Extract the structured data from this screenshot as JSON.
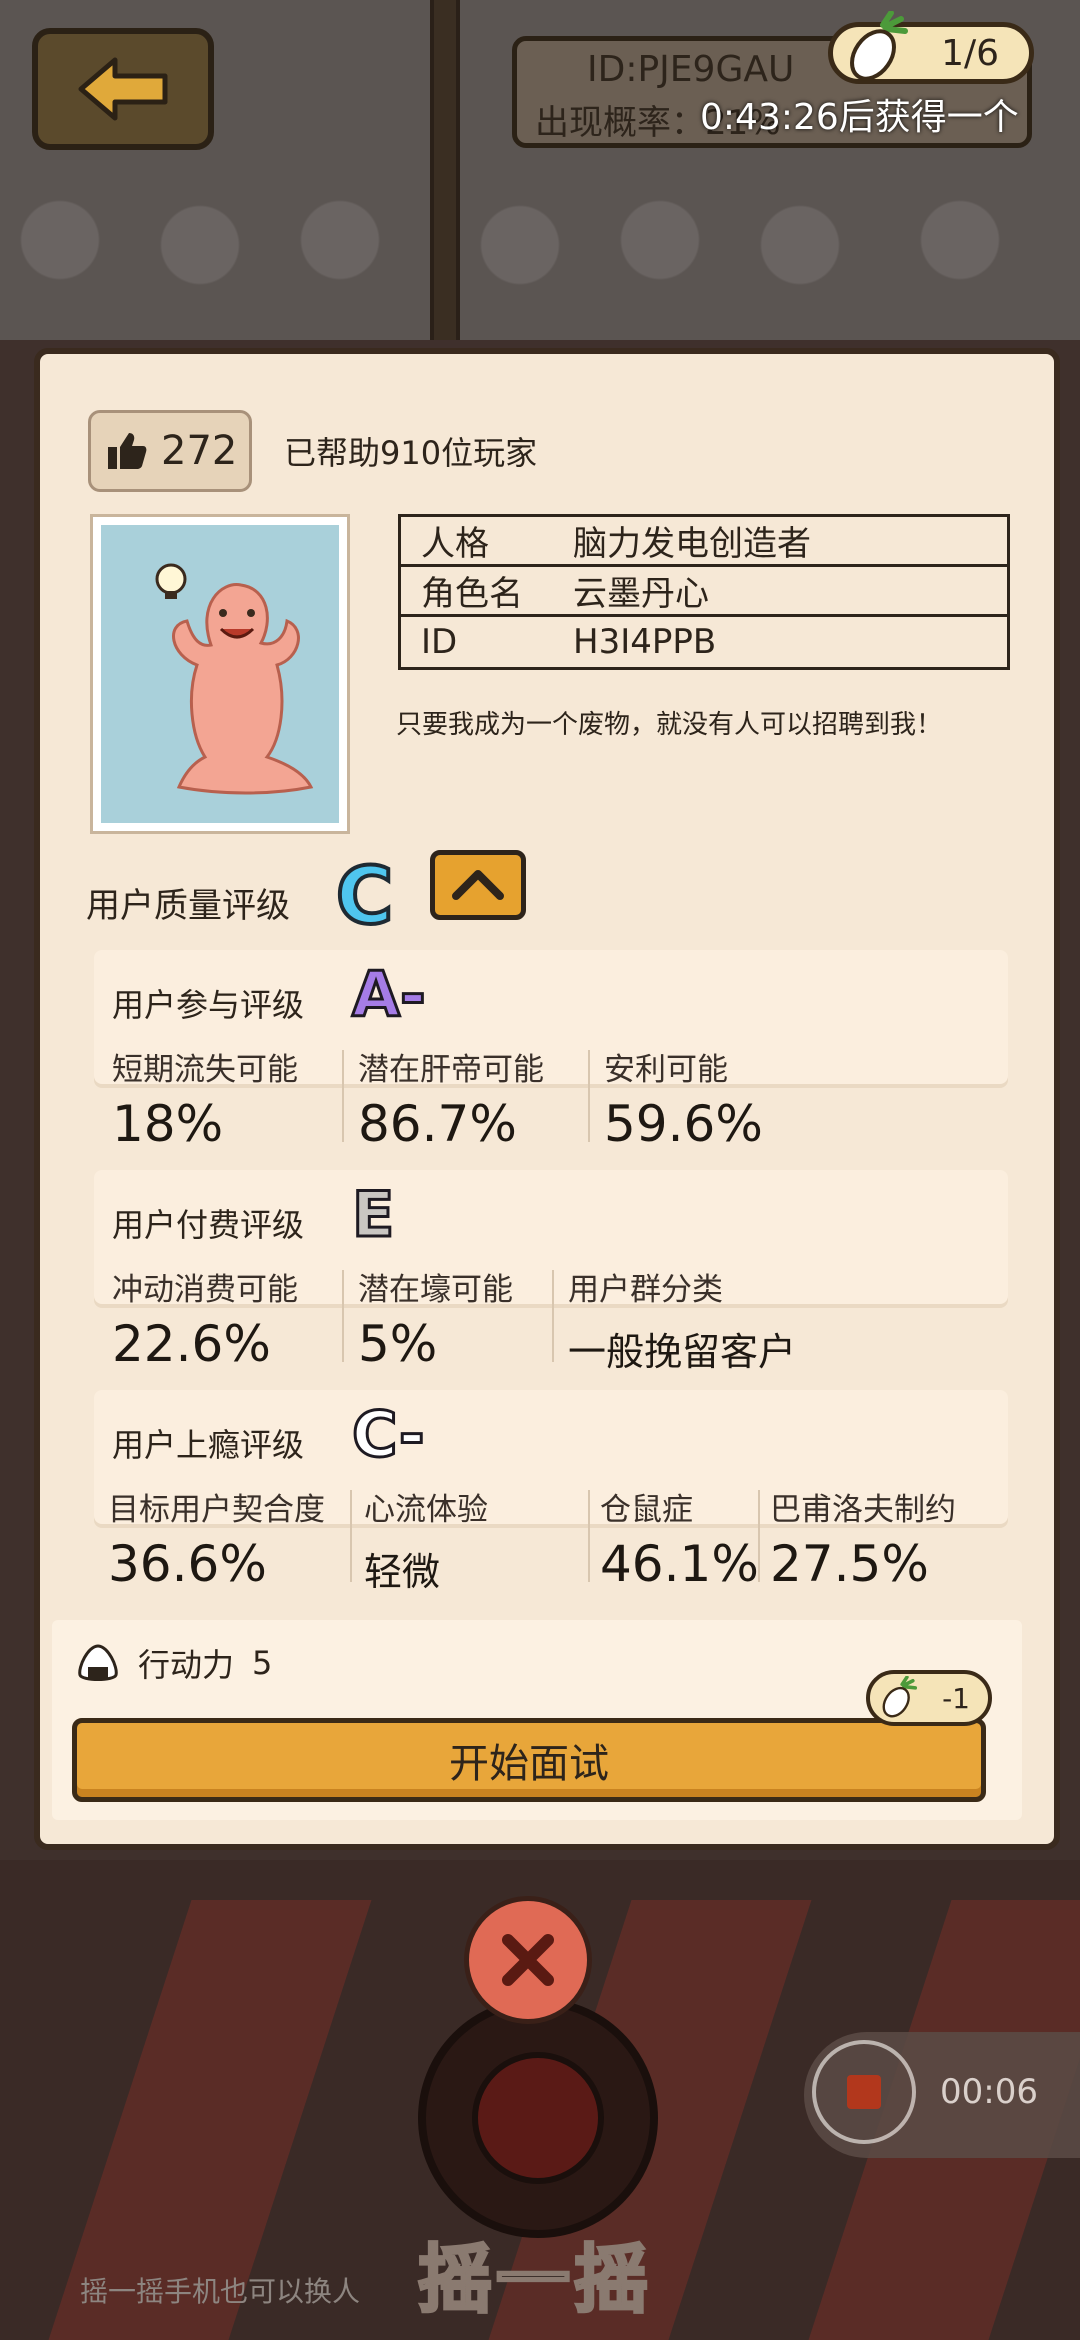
{
  "header": {
    "id_text": "ID:PJE9GAU",
    "prob_text": "出现概率：21%",
    "timer_text": "0:43:26后获得一个",
    "radish_count": "1/6"
  },
  "card": {
    "likes": "272",
    "helped_text": "已帮助910位玩家",
    "info": [
      {
        "key": "人格",
        "value": "脑力发电创造者"
      },
      {
        "key": "角色名",
        "value": "云墨丹心"
      },
      {
        "key": "ID",
        "value": "H3I4PPB"
      }
    ],
    "quote": "只要我成为一个废物，就没有人可以招聘到我！",
    "quality_label": "用户质量评级",
    "quality_grade": "C"
  },
  "sections": [
    {
      "title": "用户参与评级",
      "grade": "A-",
      "grade_color": "#a57ce6",
      "metrics": [
        {
          "label": "短期流失可能",
          "value": "18%"
        },
        {
          "label": "潜在肝帝可能",
          "value": "86.7%"
        },
        {
          "label": "安利可能",
          "value": "59.6%"
        }
      ]
    },
    {
      "title": "用户付费评级",
      "grade": "E",
      "grade_color": "#c9c6c2",
      "metrics": [
        {
          "label": "冲动消费可能",
          "value": "22.6%"
        },
        {
          "label": "潜在壕可能",
          "value": "5%"
        },
        {
          "label": "用户群分类",
          "value": "一般挽留客户"
        }
      ]
    },
    {
      "title": "用户上瘾评级",
      "grade": "C-",
      "grade_color": "#ffffff",
      "metrics": [
        {
          "label": "目标用户契合度",
          "value": "36.6%"
        },
        {
          "label": "心流体验",
          "value": "轻微"
        },
        {
          "label": "仓鼠症",
          "value": "46.1%"
        },
        {
          "label": "巴甫洛夫制约",
          "value": "27.5%"
        }
      ]
    }
  ],
  "action": {
    "energy_label": "行动力",
    "energy_value": "5",
    "cost": "-1",
    "start_label": "开始面试"
  },
  "bottom": {
    "shake_label": "摇一摇",
    "shake_hint": "摇一摇手机也可以换人",
    "record_time": "00:06"
  },
  "icons": [
    "back-arrow-icon",
    "radish-icon",
    "thumbs-up-icon",
    "chevron-up-icon",
    "rice-ball-icon",
    "close-icon",
    "record-stop-icon"
  ]
}
